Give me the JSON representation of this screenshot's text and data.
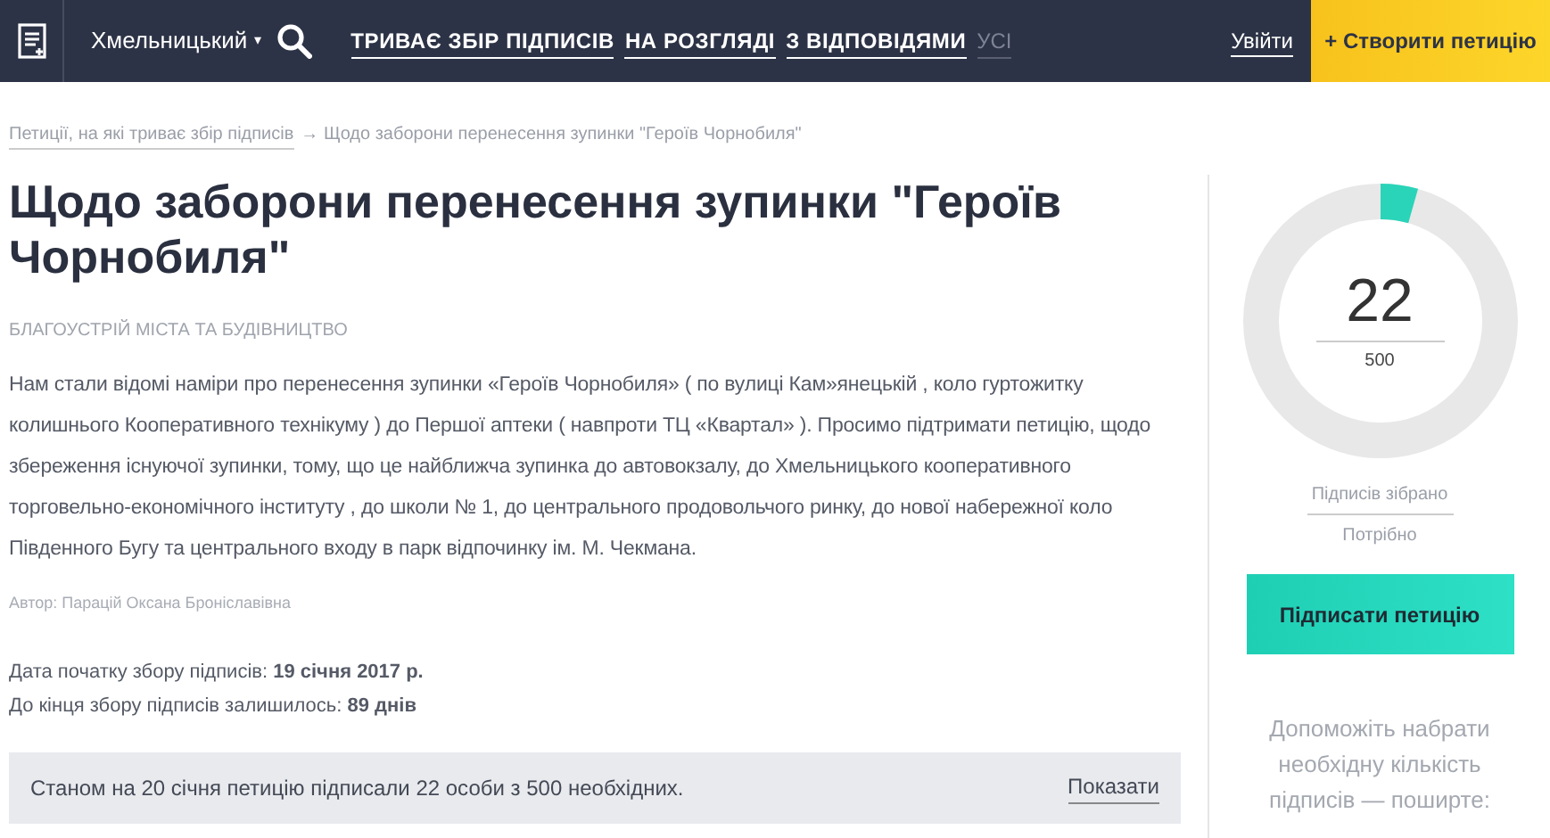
{
  "header": {
    "city": "Хмельницький",
    "city_caret": "▾",
    "nav": [
      {
        "label": "ТРИВАЄ ЗБІР ПІДПИСІВ",
        "dimmed": false
      },
      {
        "label": "НА РОЗГЛЯДІ",
        "dimmed": false
      },
      {
        "label": "З ВІДПОВІДЯМИ",
        "dimmed": false
      },
      {
        "label": "УСІ",
        "dimmed": true
      }
    ],
    "login": "Увійти",
    "create": "+ Створити петицію"
  },
  "breadcrumb": {
    "link": "Петиції, на які триває збір підписів",
    "current": "→ Щодо заборони перенесення зупинки \"Героїв Чорнобиля\""
  },
  "petition": {
    "title": "Щодо заборони перенесення зупинки \"Героїв Чорнобиля\"",
    "category": "БЛАГОУСТРІЙ МІСТА ТА БУДІВНИЦТВО",
    "body": "Нам стали відомі наміри про перенесення зупинки «Героїв Чорнобиля» ( по вулиці Кам»янецькій , коло гуртожитку колишнього Кооперативного технікуму ) до Першої аптеки ( навпроти ТЦ «Квартал» ). Просимо підтримати петицію, щодо збереження існуючої зупинки, тому, що це найближча зупинка до автовокзалу, до Хмельницького кооперативного торговельно-економічного інституту , до школи № 1, до центрального продовольчого ринку, до нової набережної коло Південного Бугу та центрального входу в парк відпочинку ім. М. Чекмана.",
    "author": "Автор: Парацій Оксана Броніславівна",
    "start": "Дата початку збору підписів: **19 січня 2017 р.**",
    "remaining": "До кінця збору підписів залишилось: **89 днів**",
    "status": "Станом на 20 січня петицію підписали 22 особи з 500 необхідних.",
    "show": "Показати"
  },
  "sidebar": {
    "count": "22",
    "needed": "500",
    "collected_label": "Підписів зібрано",
    "needed_label": "Потрібно",
    "sign": "Підписати петицію",
    "share": "Допоможіть набрати необхідну кількість підписів — поширте:"
  }
}
